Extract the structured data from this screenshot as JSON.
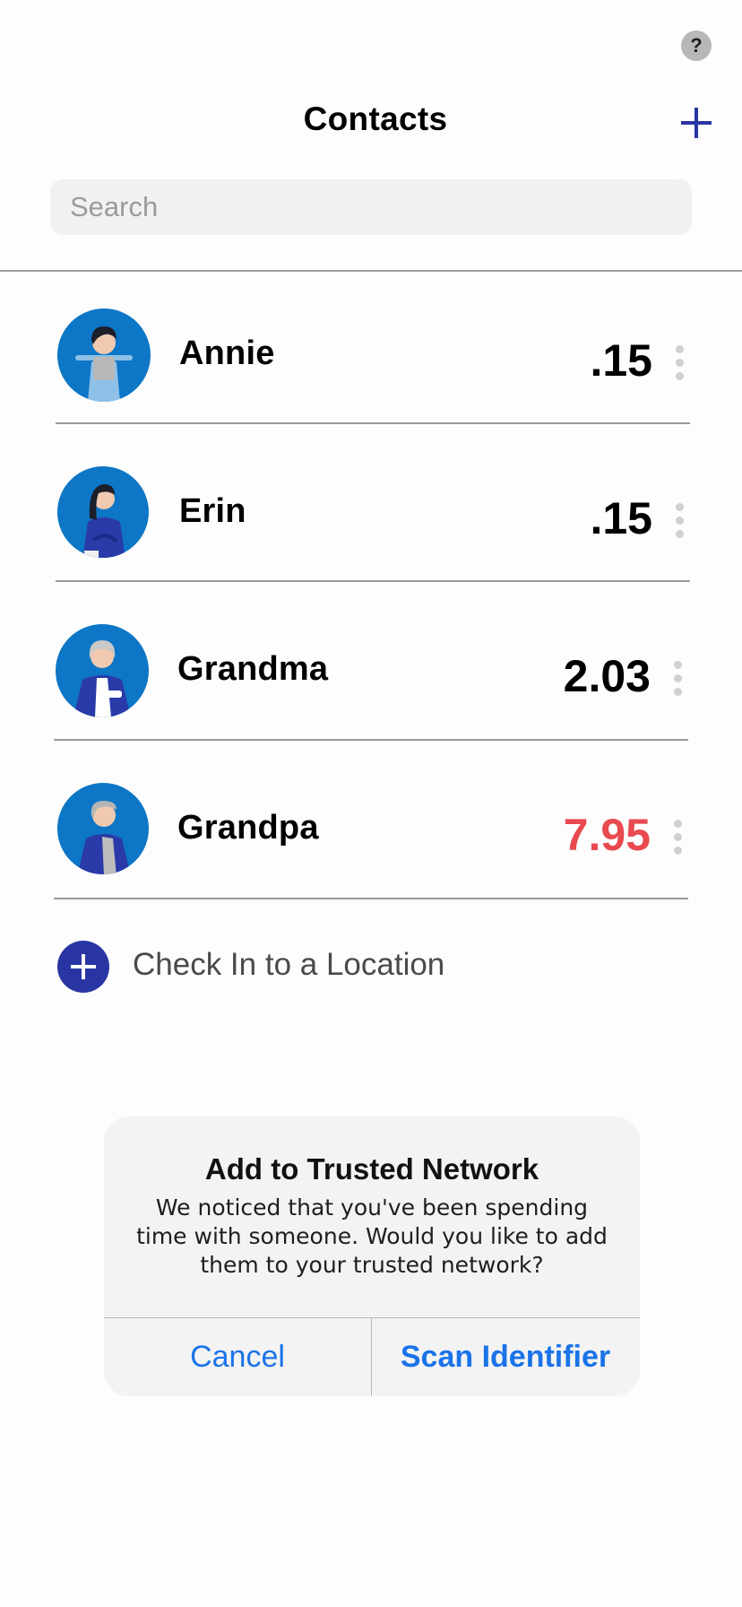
{
  "header": {
    "title": "Contacts",
    "help_label": "?",
    "add_icon": "plus-icon"
  },
  "search": {
    "placeholder": "Search"
  },
  "contacts": [
    {
      "name": "Annie",
      "score": ".15",
      "score_color": "#000000",
      "avatar_icon": "avatar-annie"
    },
    {
      "name": "Erin",
      "score": ".15",
      "score_color": "#000000",
      "avatar_icon": "avatar-erin"
    },
    {
      "name": "Grandma",
      "score": "2.03",
      "score_color": "#000000",
      "avatar_icon": "avatar-grandma"
    },
    {
      "name": "Grandpa",
      "score": "7.95",
      "score_color": "#e84a4f",
      "avatar_icon": "avatar-grandpa"
    }
  ],
  "checkin": {
    "label": "Check In to a Location",
    "icon": "plus-circle-icon"
  },
  "dialog": {
    "title": "Add to Trusted Network",
    "message": "We noticed that you've been spending time with someone. Would you like to add them to your trusted network?",
    "cancel_label": "Cancel",
    "confirm_label": "Scan Identifier"
  },
  "colors": {
    "accent": "#2935a3",
    "link": "#1a73e8",
    "avatar_bg": "#0d76c6",
    "alert_score": "#e84a4f"
  }
}
